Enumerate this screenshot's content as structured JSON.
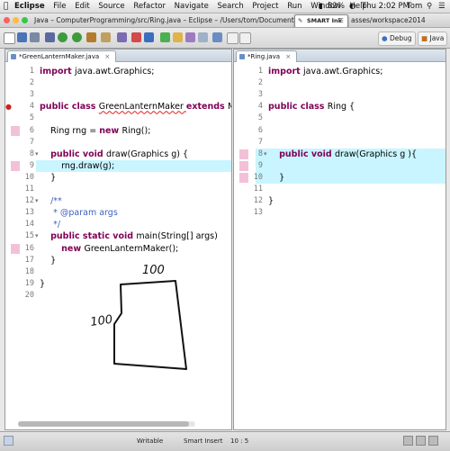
{
  "menubar": {
    "app": "Eclipse",
    "items": [
      "File",
      "Edit",
      "Source",
      "Refactor",
      "Navigate",
      "Search",
      "Project",
      "Run",
      "Window",
      "Help"
    ],
    "battery": "82%",
    "clock": "Thu 2:02 PM",
    "user": "Tom"
  },
  "titlebar": {
    "title": "Java – ComputerProgramming/src/Ring.java – Eclipse – /Users/tom/Documents/Work/1 Te",
    "smartink": "SMART Ink",
    "title_tail": "asses/workspace2014"
  },
  "toolbar": {
    "debug_label": "Debug",
    "java_label": "Java"
  },
  "left_editor": {
    "tab": "*GreenLanternMaker.java",
    "lines": [
      {
        "n": "1",
        "segs": [
          {
            "t": "import ",
            "c": "kw"
          },
          {
            "t": "java.awt.Graphics;",
            "c": ""
          }
        ]
      },
      {
        "n": "2",
        "segs": []
      },
      {
        "n": "3",
        "segs": []
      },
      {
        "n": "4",
        "segs": [
          {
            "t": "public class ",
            "c": "kw"
          },
          {
            "t": "GreenLanternMaker ",
            "c": "err"
          },
          {
            "t": "extends ",
            "c": "kw"
          },
          {
            "t": "MyW",
            "c": ""
          }
        ]
      },
      {
        "n": "5",
        "segs": []
      },
      {
        "n": "6",
        "segs": [
          {
            "t": "    Ring rng = ",
            "c": ""
          },
          {
            "t": "new ",
            "c": "kw"
          },
          {
            "t": "Ring();",
            "c": ""
          }
        ]
      },
      {
        "n": "7",
        "segs": []
      },
      {
        "n": "8",
        "segs": [
          {
            "t": "    ",
            "c": ""
          },
          {
            "t": "public void ",
            "c": "kw"
          },
          {
            "t": "draw(Graphics g) {",
            "c": ""
          }
        ]
      },
      {
        "n": "9",
        "segs": [
          {
            "t": "        rng.draw(g);",
            "c": ""
          }
        ]
      },
      {
        "n": "10",
        "segs": [
          {
            "t": "    }",
            "c": ""
          }
        ]
      },
      {
        "n": "11",
        "segs": []
      },
      {
        "n": "12",
        "segs": [
          {
            "t": "    /**",
            "c": "cm"
          }
        ]
      },
      {
        "n": "13",
        "segs": [
          {
            "t": "     * ",
            "c": "cm"
          },
          {
            "t": "@param ",
            "c": "cm"
          },
          {
            "t": "args",
            "c": "cm"
          }
        ]
      },
      {
        "n": "14",
        "segs": [
          {
            "t": "     */",
            "c": "cm"
          }
        ]
      },
      {
        "n": "15",
        "segs": [
          {
            "t": "    ",
            "c": ""
          },
          {
            "t": "public static void ",
            "c": "kw"
          },
          {
            "t": "main(String[] args)",
            "c": ""
          }
        ]
      },
      {
        "n": "16",
        "segs": [
          {
            "t": "        ",
            "c": ""
          },
          {
            "t": "new ",
            "c": "kw"
          },
          {
            "t": "GreenLanternMaker();",
            "c": ""
          }
        ]
      },
      {
        "n": "17",
        "segs": [
          {
            "t": "    }",
            "c": ""
          }
        ]
      },
      {
        "n": "18",
        "segs": []
      },
      {
        "n": "19",
        "segs": [
          {
            "t": "}",
            "c": ""
          }
        ]
      },
      {
        "n": "20",
        "segs": []
      }
    ]
  },
  "right_editor": {
    "tab": "*Ring.java",
    "lines": [
      {
        "n": "1",
        "segs": [
          {
            "t": "import ",
            "c": "kw"
          },
          {
            "t": "java.awt.Graphics;",
            "c": ""
          }
        ]
      },
      {
        "n": "2",
        "segs": []
      },
      {
        "n": "3",
        "segs": []
      },
      {
        "n": "4",
        "segs": [
          {
            "t": "public class ",
            "c": "kw"
          },
          {
            "t": "Ring {",
            "c": ""
          }
        ]
      },
      {
        "n": "5",
        "segs": []
      },
      {
        "n": "6",
        "segs": []
      },
      {
        "n": "7",
        "segs": []
      },
      {
        "n": "8",
        "segs": [
          {
            "t": "    ",
            "c": ""
          },
          {
            "t": "public void ",
            "c": "kw"
          },
          {
            "t": "draw(Graphics g ){",
            "c": ""
          }
        ]
      },
      {
        "n": "9",
        "segs": []
      },
      {
        "n": "10",
        "segs": [
          {
            "t": "    }",
            "c": ""
          }
        ]
      },
      {
        "n": "11",
        "segs": []
      },
      {
        "n": "12",
        "segs": [
          {
            "t": "}",
            "c": ""
          }
        ]
      },
      {
        "n": "13",
        "segs": []
      }
    ]
  },
  "ink": {
    "label_top": "100",
    "label_left": "100"
  },
  "statusbar": {
    "writable": "Writable",
    "insert_mode": "Smart Insert",
    "position": "10 : 5"
  },
  "colors": {
    "keyword": "#7f0055",
    "comment": "#3f5fbf",
    "highlight": "#c8f5ff",
    "marker": "#f2c1d8"
  }
}
